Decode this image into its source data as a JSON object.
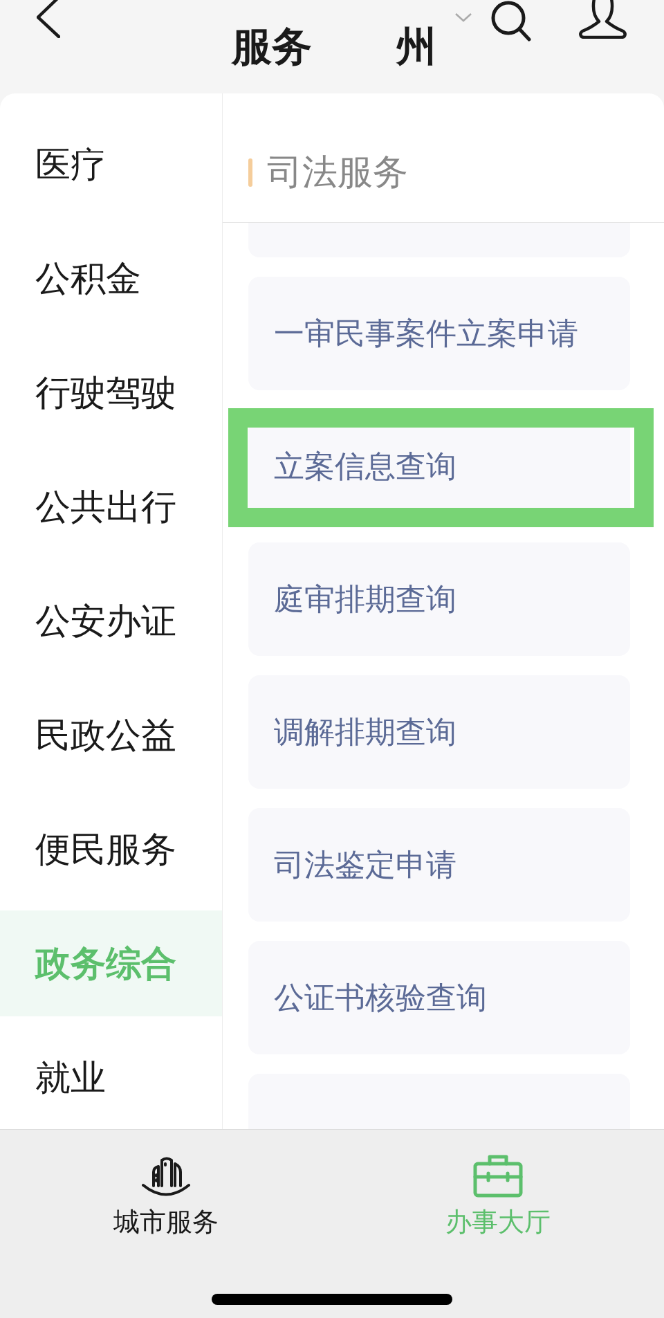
{
  "header": {
    "title": "服务",
    "city": "州"
  },
  "sidebar": {
    "items": [
      {
        "label": "医疗",
        "selected": false
      },
      {
        "label": "公积金",
        "selected": false
      },
      {
        "label": "行驶驾驶",
        "selected": false
      },
      {
        "label": "公共出行",
        "selected": false
      },
      {
        "label": "公安办证",
        "selected": false
      },
      {
        "label": "民政公益",
        "selected": false
      },
      {
        "label": "便民服务",
        "selected": false
      },
      {
        "label": "政务综合",
        "selected": true
      },
      {
        "label": "就业",
        "selected": false
      }
    ]
  },
  "section": {
    "title": "司法服务",
    "items": [
      {
        "label": "一审民事案件立案申请",
        "highlighted": false
      },
      {
        "label": "立案信息查询",
        "highlighted": true
      },
      {
        "label": "庭审排期查询",
        "highlighted": false
      },
      {
        "label": "调解排期查询",
        "highlighted": false
      },
      {
        "label": "司法鉴定申请",
        "highlighted": false
      },
      {
        "label": "公证书核验查询",
        "highlighted": false
      }
    ]
  },
  "tab_bar": {
    "tabs": [
      {
        "kind": "city",
        "label": "城市服务",
        "selected": false
      },
      {
        "kind": "hall",
        "label": "办事大厅",
        "selected": true
      }
    ]
  }
}
